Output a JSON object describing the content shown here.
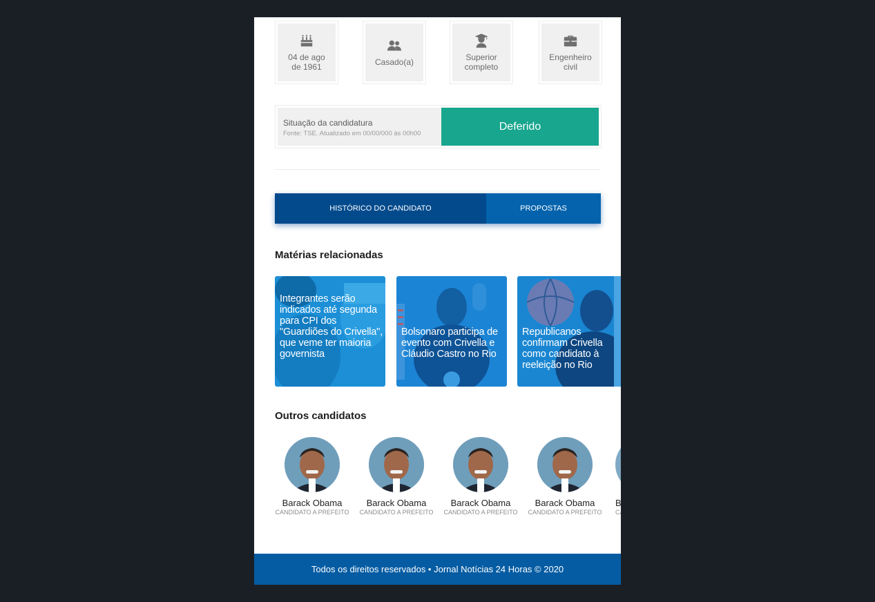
{
  "info_cards": [
    {
      "icon": "birthday-cake-icon",
      "text": "04 de ago\nde 1961"
    },
    {
      "icon": "users-icon",
      "text": "Casado(a)"
    },
    {
      "icon": "graduate-icon",
      "text": "Superior\ncompleto"
    },
    {
      "icon": "briefcase-icon",
      "text": "Engenheiro\ncivil"
    }
  ],
  "status": {
    "title": "Situação da candidatura",
    "source": "Fonte: TSE. Atualizado em 00/00/000 às 00h00",
    "value": "Deferido",
    "color": "#18a68e"
  },
  "tabs": [
    {
      "label": "HISTÓRICO DO CANDIDATO"
    },
    {
      "label": "PROPOSTAS"
    }
  ],
  "related": {
    "title": "Matérias relacionadas",
    "items": [
      {
        "headline": "Integrantes serão indicados até segunda para CPI dos \"Guardiões do Crivella\", que veme ter maioria governista"
      },
      {
        "headline": "Bolsonaro participa de evento com Crivella e Cláudio Castro no Rio"
      },
      {
        "headline": "Republicanos confirmam Crivella como candidato à reeleição no Rio"
      }
    ]
  },
  "others": {
    "title": "Outros candidatos",
    "items": [
      {
        "name": "Barack Obama",
        "role": "CANDIDATO A PREFEITO"
      },
      {
        "name": "Barack Obama",
        "role": "CANDIDATO A PREFEITO"
      },
      {
        "name": "Barack Obama",
        "role": "CANDIDATO A PREFEITO"
      },
      {
        "name": "Barack Obama",
        "role": "CANDIDATO A PREFEITO"
      },
      {
        "name": "Barack Obama",
        "role": "CANDIDATO A PREFEITO"
      }
    ]
  },
  "footer": {
    "text": "Todos os direitos reservados • Jornal Notícias 24 Horas © 2020"
  },
  "colors": {
    "primary": "#055ca3",
    "tab_active": "#024a8c",
    "success": "#18a68e"
  }
}
